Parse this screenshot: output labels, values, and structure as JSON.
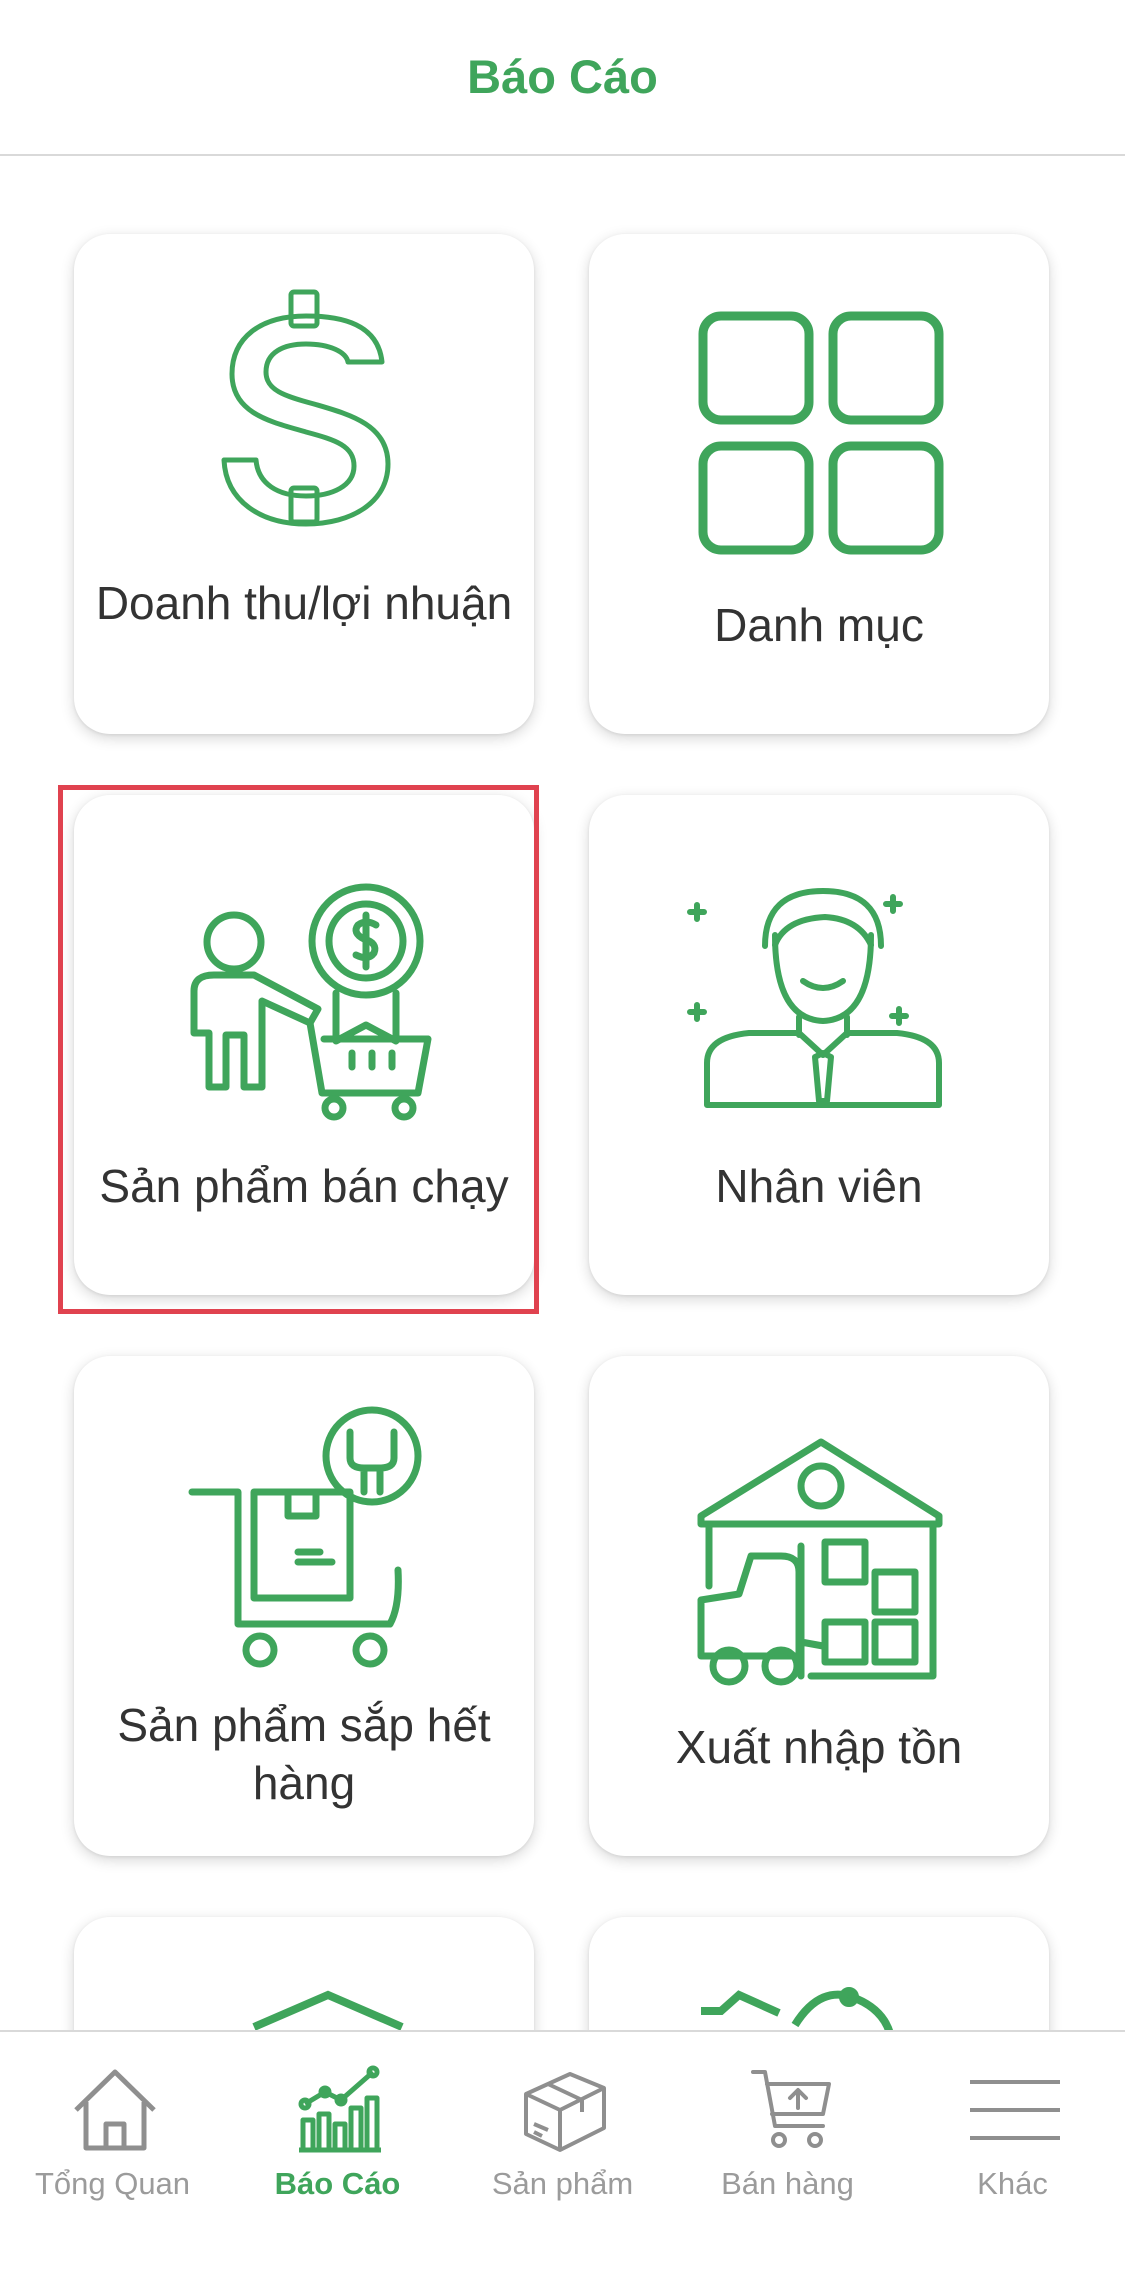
{
  "header": {
    "title": "Báo Cáo"
  },
  "cards": [
    {
      "label": "Doanh thu/lợi nhuận",
      "icon": "dollar-icon"
    },
    {
      "label": "Danh mục",
      "icon": "grid-icon"
    },
    {
      "label": "Sản phẩm bán chạy",
      "icon": "best-seller-icon",
      "highlighted": true
    },
    {
      "label": "Nhân viên",
      "icon": "employee-icon"
    },
    {
      "label": "Sản phẩm sắp hết hàng",
      "icon": "low-stock-icon"
    },
    {
      "label": "Xuất nhập tồn",
      "icon": "warehouse-icon"
    }
  ],
  "tabbar": {
    "items": [
      {
        "label": "Tổng Quan",
        "icon": "home-icon",
        "active": false
      },
      {
        "label": "Báo Cáo",
        "icon": "report-chart-icon",
        "active": true
      },
      {
        "label": "Sản phẩm",
        "icon": "box-icon",
        "active": false
      },
      {
        "label": "Bán hàng",
        "icon": "cart-icon",
        "active": false
      },
      {
        "label": "Khác",
        "icon": "menu-icon",
        "active": false
      }
    ]
  },
  "colors": {
    "accent": "#3fa55b",
    "highlight": "#e0424f",
    "inactive": "#9b9b9b"
  }
}
